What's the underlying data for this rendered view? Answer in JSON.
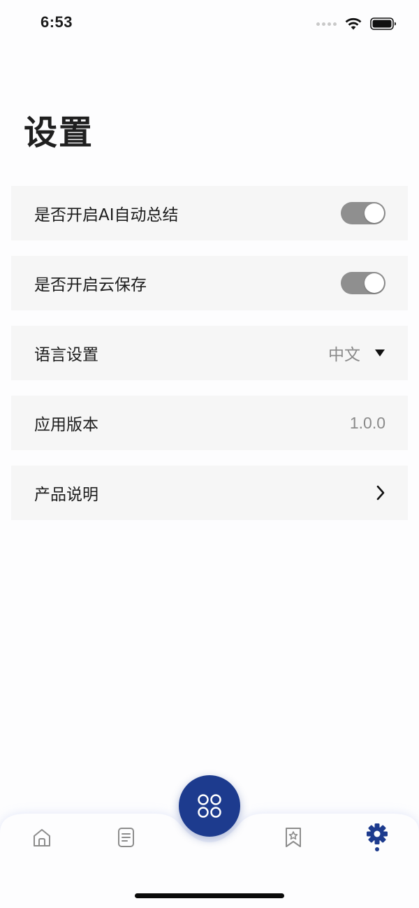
{
  "status_bar": {
    "time": "6:53"
  },
  "header": {
    "title": "设置"
  },
  "settings": {
    "ai_summary": {
      "label": "是否开启AI自动总结",
      "enabled": true
    },
    "cloud_save": {
      "label": "是否开启云保存",
      "enabled": true
    },
    "language": {
      "label": "语言设置",
      "value": "中文"
    },
    "version": {
      "label": "应用版本",
      "value": "1.0.0"
    },
    "product_info": {
      "label": "产品说明"
    }
  },
  "tab_bar": {
    "items": [
      {
        "icon": "home-icon",
        "active": false
      },
      {
        "icon": "document-icon",
        "active": false
      },
      {
        "icon": "grid-icon",
        "active": false,
        "center": true
      },
      {
        "icon": "bookmark-star-icon",
        "active": false
      },
      {
        "icon": "gear-icon",
        "active": true
      }
    ],
    "accent_color": "#1d3b8e",
    "inactive_color": "#8c8c8c"
  }
}
